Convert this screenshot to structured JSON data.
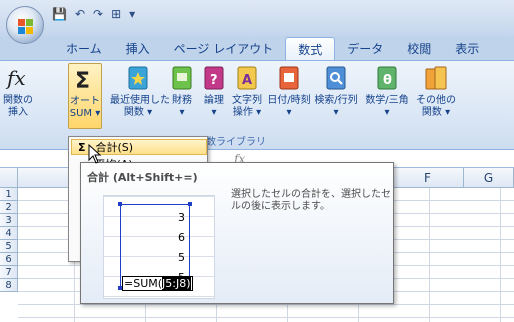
{
  "qat": {
    "save": "💾",
    "undo": "↶",
    "redo": "↷",
    "border": "⊞",
    "customize": "▾"
  },
  "tabs": [
    "ホーム",
    "挿入",
    "ページ レイアウト",
    "数式",
    "データ",
    "校閲",
    "表示"
  ],
  "active_tab": "数式",
  "ribbon": {
    "insert_function": {
      "line1": "関数の",
      "line2": "挿入"
    },
    "autosum": {
      "line1": "オート",
      "line2": "SUM ▾"
    },
    "recent": {
      "line1": "最近使用した",
      "line2": "関数 ▾"
    },
    "financial": {
      "line1": "財務",
      "line2": "▾"
    },
    "logical": {
      "line1": "論理",
      "line2": "▾"
    },
    "text": {
      "line1": "文字列",
      "line2": "操作 ▾"
    },
    "datetime": {
      "line1": "日付/時刻",
      "line2": "▾"
    },
    "lookup": {
      "line1": "検索/行列",
      "line2": "▾"
    },
    "math": {
      "line1": "数学/三角",
      "line2": "▾"
    },
    "more": {
      "line1": "その他の",
      "line2": "関数 ▾"
    },
    "group_label": "関数ライブラリ"
  },
  "formula_bar": {
    "fx": "fx"
  },
  "columns": [
    "F",
    "G"
  ],
  "rows": [
    "1",
    "2",
    "3",
    "4",
    "5",
    "6",
    "7",
    "8"
  ],
  "dropdown": {
    "items": [
      {
        "icon": "Σ",
        "label": "合計(S)"
      },
      {
        "icon": "",
        "label": "平均(A)"
      }
    ]
  },
  "tooltip": {
    "title": "合計 (Alt+Shift+=)",
    "description": "選択したセルの合計を、選択したセルの後に表示します。",
    "values": [
      "3",
      "6",
      "5",
      "5"
    ],
    "formula_prefix": "=SUM(",
    "formula_ref": "J5:J8)"
  }
}
